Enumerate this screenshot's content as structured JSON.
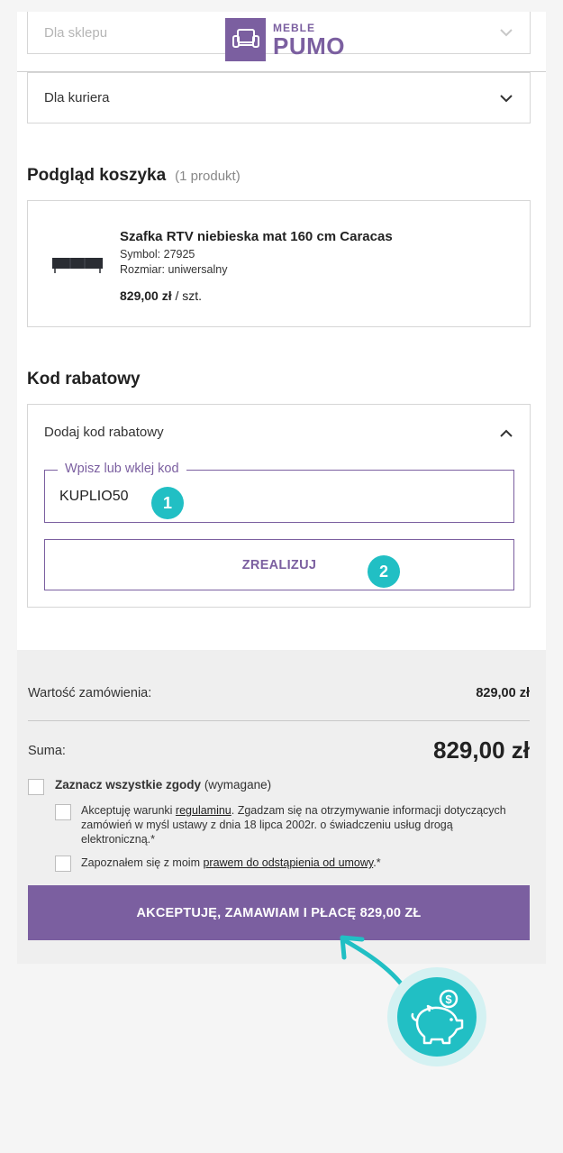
{
  "header": {
    "logo_small": "MEBLE",
    "logo_big": "PUMO"
  },
  "delivery": {
    "option_shop": "Dla sklepu",
    "option_courier": "Dla kuriera"
  },
  "cart": {
    "title": "Podgląd koszyka",
    "count": "(1 produkt)",
    "product": {
      "name": "Szafka RTV niebieska mat 160 cm Caracas",
      "symbol": "Symbol: 27925",
      "size": "Rozmiar: uniwersalny",
      "price": "829,00 zł",
      "unit": " / szt."
    }
  },
  "discount": {
    "title": "Kod rabatowy",
    "toggle_label": "Dodaj kod rabatowy",
    "input_label": "Wpisz lub wklej kod",
    "input_value": "KUPLIO50",
    "apply_label": "ZREALIZUJ",
    "step1": "1",
    "step2": "2"
  },
  "summary": {
    "order_value_label": "Wartość zamówienia:",
    "order_value": "829,00 zł",
    "total_label": "Suma:",
    "total_value": "829,00 zł",
    "consent_all_bold": "Zaznacz wszystkie zgody",
    "consent_all_note": " (wymagane)",
    "consent1_pre": "Akceptuję warunki ",
    "consent1_link": "regulaminu",
    "consent1_post": ". Zgadzam się na otrzymywanie informacji dotyczących zamówień w myśl ustawy z dnia 18 lipca 2002r. o świadczeniu usług drogą elektroniczną.*",
    "consent2_pre": "Zapoznałem się z moim ",
    "consent2_link": "prawem do odstąpienia od umowy",
    "consent2_post": ".*",
    "pay_label": "AKCEPTUJĘ, ZAMAWIAM I PŁACĘ  829,00 ZŁ"
  },
  "colors": {
    "brand": "#7b5fa0",
    "accent": "#21bfc4"
  },
  "icons": {
    "logo": "armchair-icon",
    "chevron": "chevron-down-icon",
    "chevron_up": "chevron-up-icon",
    "piggy": "piggy-bank-icon",
    "arrow": "curved-arrow-icon"
  }
}
